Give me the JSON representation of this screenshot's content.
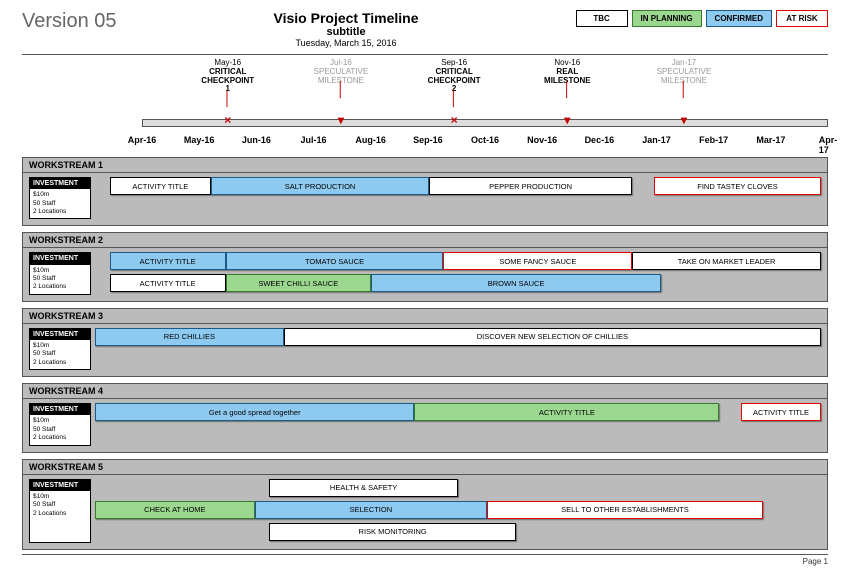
{
  "header": {
    "version": "Version 05",
    "title": "Visio Project Timeline",
    "subtitle": "subtitle",
    "date": "Tuesday, March 15, 2016"
  },
  "legend": {
    "tbc": "TBC",
    "planning": "IN PLANNING",
    "confirmed": "CONFIRMED",
    "atrisk": "AT RISK"
  },
  "milestones": [
    {
      "pos": 12.5,
      "month": "May-16",
      "name": "CRITICAL CHECKPOINT",
      "num": "1",
      "spec": false,
      "marker": "×"
    },
    {
      "pos": 29,
      "month": "Jul-16",
      "name": "SPECULATIVE MILESTONE",
      "num": "",
      "spec": true,
      "marker": "▾"
    },
    {
      "pos": 45.5,
      "month": "Sep-16",
      "name": "CRITICAL CHECKPOINT",
      "num": "2",
      "spec": false,
      "marker": "×"
    },
    {
      "pos": 62,
      "month": "Nov-16",
      "name": "REAL MILESTONE",
      "num": "",
      "spec": false,
      "marker": "▾"
    },
    {
      "pos": 79,
      "month": "Jan-17",
      "name": "SPECULATIVE MILESTONE",
      "num": "",
      "spec": true,
      "marker": "▾"
    }
  ],
  "axis": [
    "Apr-16",
    "May-16",
    "Jun-16",
    "Jul-16",
    "Aug-16",
    "Sep-16",
    "Oct-16",
    "Nov-16",
    "Dec-16",
    "Jan-17",
    "Feb-17",
    "Mar-17",
    "Apr-17"
  ],
  "investment": {
    "head": "INVESTMENT",
    "line1": "$10m",
    "line2": "50 Staff",
    "line3": "2 Locations"
  },
  "workstreams": [
    {
      "title": "WORKSTREAM 1",
      "lanes": [
        [
          {
            "label": "ACTIVITY TITLE",
            "start": 2,
            "end": 16,
            "status": "tbc"
          },
          {
            "label": "SALT PRODUCTION",
            "start": 16,
            "end": 46,
            "status": "confirmed"
          },
          {
            "label": "PEPPER PRODUCTION",
            "start": 46,
            "end": 74,
            "status": "tbc"
          },
          {
            "label": "FIND TASTEY CLOVES",
            "start": 77,
            "end": 100,
            "status": "atrisk"
          }
        ]
      ]
    },
    {
      "title": "WORKSTREAM 2",
      "lanes": [
        [
          {
            "label": "ACTIVITY TITLE",
            "start": 2,
            "end": 18,
            "status": "confirmed"
          },
          {
            "label": "TOMATO SAUCE",
            "start": 18,
            "end": 48,
            "status": "confirmed"
          },
          {
            "label": "SOME FANCY SAUCE",
            "start": 48,
            "end": 74,
            "status": "atrisk"
          },
          {
            "label": "TAKE ON MARKET LEADER",
            "start": 74,
            "end": 100,
            "status": "tbc"
          }
        ],
        [
          {
            "label": "ACTIVITY TITLE",
            "start": 2,
            "end": 18,
            "status": "tbc"
          },
          {
            "label": "SWEET CHILLI SAUCE",
            "start": 18,
            "end": 38,
            "status": "planning"
          },
          {
            "label": "BROWN SAUCE",
            "start": 38,
            "end": 78,
            "status": "confirmed"
          }
        ]
      ]
    },
    {
      "title": "WORKSTREAM 3",
      "lanes": [
        [
          {
            "label": "RED CHILLIES",
            "start": 0,
            "end": 26,
            "status": "confirmed"
          },
          {
            "label": "DISCOVER NEW SELECTION OF CHILLIES",
            "start": 26,
            "end": 100,
            "status": "tbc"
          }
        ]
      ]
    },
    {
      "title": "WORKSTREAM 4",
      "lanes": [
        [
          {
            "label": "Get a good spread together",
            "start": 0,
            "end": 44,
            "status": "confirmed"
          },
          {
            "label": "ACTIVITY TITLE",
            "start": 44,
            "end": 86,
            "status": "planning"
          },
          {
            "label": "ACTIVITY TITLE",
            "start": 89,
            "end": 100,
            "status": "atrisk"
          }
        ]
      ]
    },
    {
      "title": "WORKSTREAM 5",
      "lanes": [
        [
          {
            "label": "HEALTH & SAFETY",
            "start": 24,
            "end": 50,
            "status": "tbc"
          }
        ],
        [
          {
            "label": "CHECK AT HOME",
            "start": 0,
            "end": 22,
            "status": "planning"
          },
          {
            "label": "SELECTION",
            "start": 22,
            "end": 54,
            "status": "confirmed"
          },
          {
            "label": "SELL TO OTHER ESTABLISHMENTS",
            "start": 54,
            "end": 92,
            "status": "atrisk"
          }
        ],
        [
          {
            "label": "RISK MONITORING",
            "start": 24,
            "end": 58,
            "status": "tbc"
          }
        ]
      ]
    }
  ],
  "footer": "Page 1"
}
